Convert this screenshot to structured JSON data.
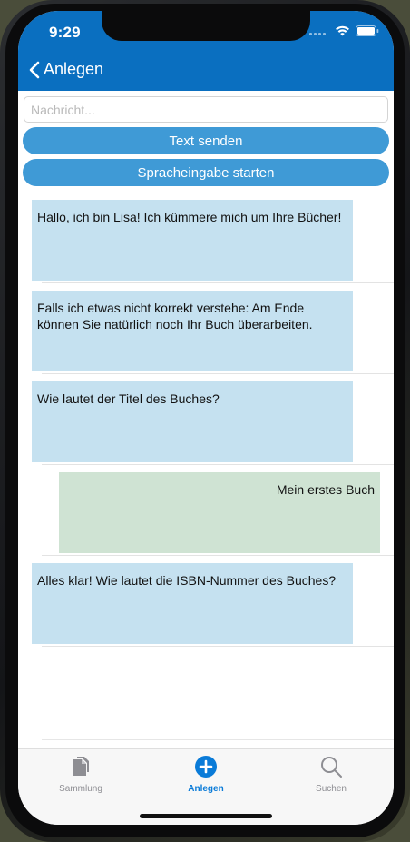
{
  "status_bar": {
    "time": "9:29"
  },
  "nav": {
    "back_label": "Anlegen"
  },
  "composer": {
    "placeholder": "Nachricht...",
    "send_label": "Text senden",
    "voice_label": "Spracheingabe starten"
  },
  "messages": [
    {
      "from": "bot",
      "text": "Hallo, ich bin Lisa! Ich kümmere mich um Ihre Bücher!"
    },
    {
      "from": "bot",
      "text": "Falls ich etwas nicht korrekt verstehe: Am Ende können Sie natürlich noch Ihr Buch überarbeiten."
    },
    {
      "from": "bot",
      "text": "Wie lautet der Titel des Buches?"
    },
    {
      "from": "user",
      "text": "Mein erstes Buch"
    },
    {
      "from": "bot",
      "text": "Alles klar! Wie lautet die ISBN-Nummer des Buches?"
    }
  ],
  "tabs": [
    {
      "label": "Sammlung",
      "icon": "documents-icon",
      "active": false
    },
    {
      "label": "Anlegen",
      "icon": "plus-circle-icon",
      "active": true
    },
    {
      "label": "Suchen",
      "icon": "search-icon",
      "active": false
    }
  ],
  "colors": {
    "header": "#0a6fc0",
    "button": "#3f9ad6",
    "bot_bubble": "#c5e1f0",
    "user_bubble": "#cfe3d3",
    "tab_active": "#0a7bd8",
    "tab_inactive": "#8e8e93"
  }
}
